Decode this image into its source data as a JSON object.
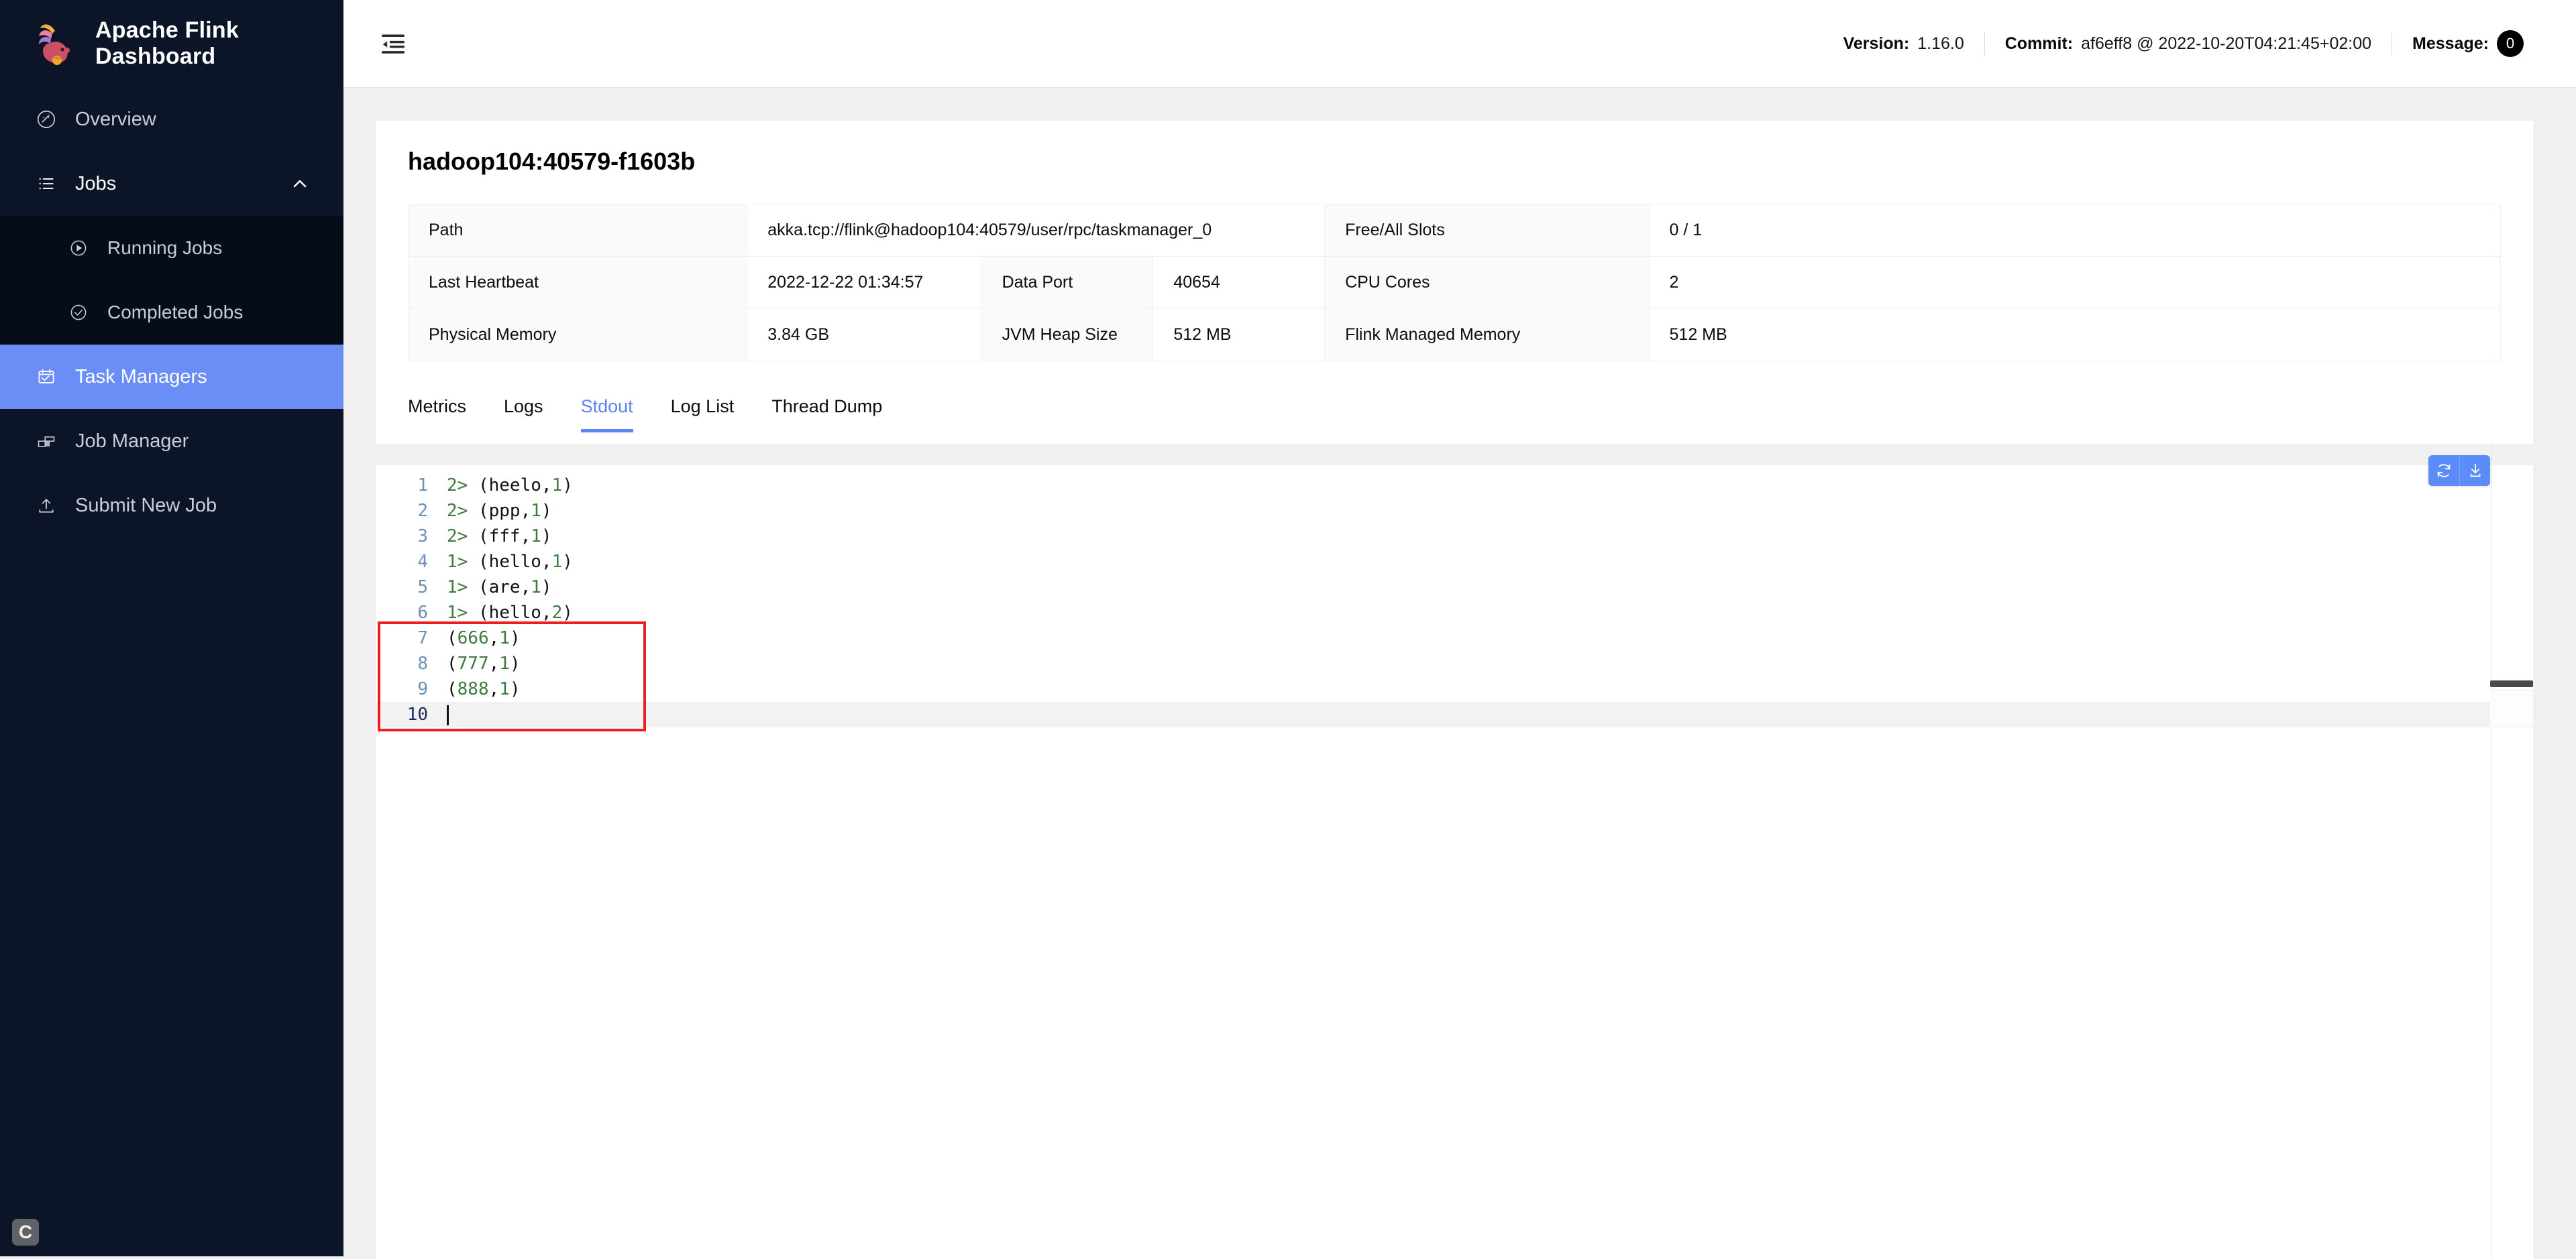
{
  "brand": {
    "title": "Apache Flink Dashboard",
    "logo_icon": "flink-squirrel-logo",
    "corner_logo_text": "C"
  },
  "sidebar": {
    "items": [
      {
        "label": "Overview",
        "icon": "dashboard-gauge-icon",
        "active": false
      },
      {
        "label": "Jobs",
        "icon": "list-icon",
        "active": false,
        "expanded": true,
        "chevron": "chevron-up-icon"
      },
      {
        "label": "Running Jobs",
        "icon": "play-circle-icon",
        "active": false,
        "child": true
      },
      {
        "label": "Completed Jobs",
        "icon": "check-circle-icon",
        "active": false,
        "child": true
      },
      {
        "label": "Task Managers",
        "icon": "task-manager-icon",
        "active": true
      },
      {
        "label": "Job Manager",
        "icon": "job-manager-icon",
        "active": false
      },
      {
        "label": "Submit New Job",
        "icon": "upload-icon",
        "active": false
      }
    ]
  },
  "header": {
    "menu_fold_icon": "menu-fold-icon",
    "version_label": "Version:",
    "version_value": "1.16.0",
    "commit_label": "Commit:",
    "commit_value": "af6eff8 @ 2022-10-20T04:21:45+02:00",
    "message_label": "Message:",
    "message_count": "0"
  },
  "taskmanager": {
    "title": "hadoop104:40579-f1603b",
    "info_rows": [
      [
        {
          "type": "key",
          "text": "Path",
          "colspan": 1
        },
        {
          "type": "value",
          "text": "akka.tcp://flink@hadoop104:40579/user/rpc/taskmanager_0",
          "colspan": 3
        },
        {
          "type": "key",
          "text": "Free/All Slots",
          "colspan": 1
        },
        {
          "type": "value",
          "text": "0 / 1",
          "colspan": 1
        }
      ],
      [
        {
          "type": "key",
          "text": "Last Heartbeat",
          "colspan": 1
        },
        {
          "type": "value",
          "text": "2022-12-22 01:34:57",
          "colspan": 1
        },
        {
          "type": "key",
          "text": "Data Port",
          "colspan": 1
        },
        {
          "type": "value",
          "text": "40654",
          "colspan": 1
        },
        {
          "type": "key",
          "text": "CPU Cores",
          "colspan": 1
        },
        {
          "type": "value",
          "text": "2",
          "colspan": 1
        }
      ],
      [
        {
          "type": "key",
          "text": "Physical Memory",
          "colspan": 1
        },
        {
          "type": "value",
          "text": "3.84 GB",
          "colspan": 1
        },
        {
          "type": "key",
          "text": "JVM Heap Size",
          "colspan": 1
        },
        {
          "type": "value",
          "text": "512 MB",
          "colspan": 1
        },
        {
          "type": "key",
          "text": "Flink Managed Memory",
          "colspan": 1
        },
        {
          "type": "value",
          "text": "512 MB",
          "colspan": 1
        }
      ]
    ],
    "tabs": [
      {
        "label": "Metrics",
        "active": false
      },
      {
        "label": "Logs",
        "active": false
      },
      {
        "label": "Stdout",
        "active": true
      },
      {
        "label": "Log List",
        "active": false
      },
      {
        "label": "Thread Dump",
        "active": false
      }
    ]
  },
  "viewer": {
    "buttons": [
      {
        "icon": "refresh-icon",
        "name": "refresh-button"
      },
      {
        "icon": "download-icon",
        "name": "download-button"
      }
    ],
    "lines": [
      {
        "num": "1",
        "prefix": "2> ",
        "body": "(heelo,1)",
        "highlight": false
      },
      {
        "num": "2",
        "prefix": "2> ",
        "body": "(ppp,1)",
        "highlight": false
      },
      {
        "num": "3",
        "prefix": "2> ",
        "body": "(fff,1)",
        "highlight": false
      },
      {
        "num": "4",
        "prefix": "1> ",
        "body": "(hello,1)",
        "highlight": false
      },
      {
        "num": "5",
        "prefix": "1> ",
        "body": "(are,1)",
        "highlight": false
      },
      {
        "num": "6",
        "prefix": "1> ",
        "body": "(hello,2)",
        "highlight": false
      },
      {
        "num": "7",
        "prefix": "",
        "body": "(666,1)",
        "highlight": false
      },
      {
        "num": "8",
        "prefix": "",
        "body": "(777,1)",
        "highlight": false
      },
      {
        "num": "9",
        "prefix": "",
        "body": "(888,1)",
        "highlight": false
      },
      {
        "num": "10",
        "prefix": "",
        "body": "",
        "highlight": true,
        "caret": true
      }
    ],
    "annotation": {
      "type": "red-rectangle",
      "covers_lines": [
        "7",
        "8",
        "9",
        "10"
      ],
      "color": "#ee1d23"
    }
  },
  "colors": {
    "sidebar_bg": "#0b1527",
    "submenu_bg": "#060c18",
    "accent": "#5b84f7",
    "active_nav": "#6b8ef6",
    "page_bg": "#f0f0f0",
    "annotation_red": "#ee1d23",
    "line_number": "#6d8fb5",
    "code_green": "#3f7a3f"
  }
}
